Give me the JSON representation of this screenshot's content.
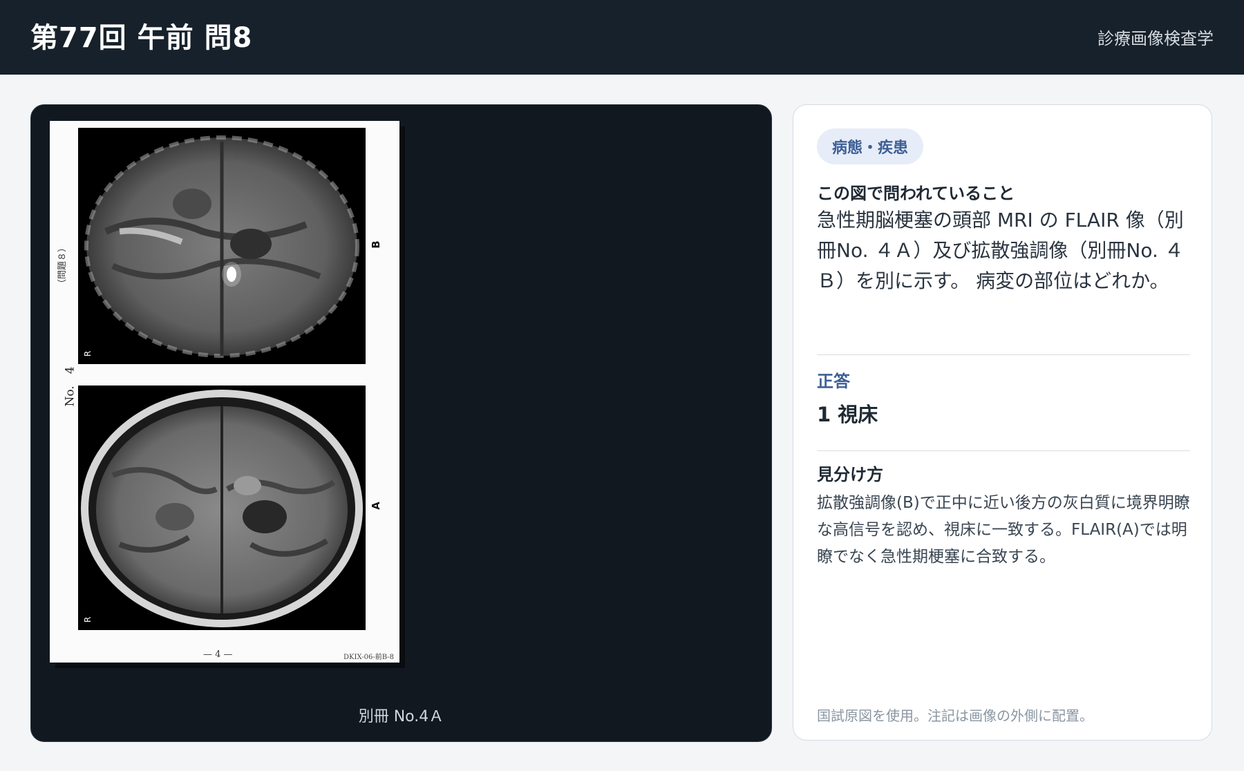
{
  "header": {
    "title": "第77回 午前 問8",
    "subject": "診療画像検査学"
  },
  "viewer": {
    "sheet": {
      "vertical_question": "（問題８）",
      "vertical_no": "No.　4",
      "label_b": "B",
      "label_a": "A",
      "orientation_mark": "R",
      "page_number": "— 4 —",
      "doc_code": "DKIX-06-前B-8"
    },
    "caption": "別冊 No.4Ａ"
  },
  "panel": {
    "tag": "病態・疾患",
    "question_heading": "この図で問われていること",
    "question_text": "急性期脳梗塞の頭部 MRI の FLAIR 像（別冊No. ４Ａ）及び拡散強調像（別冊No. ４ Ｂ）を別に示す。 病変の部位はどれか。",
    "answer_label": "正答",
    "answer_text": "1 視床",
    "tip_heading": "見分け方",
    "tip_text": "拡散強調像(B)で正中に近い後方の灰白質に境界明瞭な高信号を認め、視床に一致する。FLAIR(A)では明瞭でなく急性期梗塞に合致する。",
    "footnote": "国試原図を使用。注記は画像の外側に配置。"
  }
}
